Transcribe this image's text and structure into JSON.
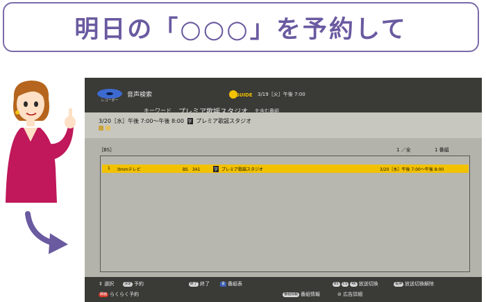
{
  "callout": {
    "text": "明日の「○○○」を予約して"
  },
  "app": {
    "title": "音声検索",
    "logo_text": "レコーダー",
    "guide_logo": "GUIDE",
    "datetime": "3/19［火］午後 7:00"
  },
  "search": {
    "keyword_label": "キーワード",
    "keyword_value": "プレミア歌謡スタジオ",
    "keyword_suffix": "を含む番組"
  },
  "info": {
    "line": "3/20［水］午後 7:00～午後 8:00",
    "title_badge": "字",
    "title": "プレミア歌謡スタジオ"
  },
  "list": {
    "section": "［BS］",
    "page": "1 ／全",
    "count": "1 番組",
    "rows": [
      {
        "num": "1",
        "channel": "itmmテレビ",
        "ch": "BS　341",
        "badge": "字",
        "title": "プレミア歌謡スタジオ",
        "time": "3/20［水］午後 7:00～午後 8:00"
      }
    ]
  },
  "bottombar": {
    "select": "選択",
    "enter_key": "決定",
    "reserve": "予約",
    "end_key": "終了",
    "end": "終了",
    "blue_key": "青",
    "schedule": "番組表",
    "bs_key": "BS",
    "cs_key": "CS",
    "k4_key": "4K",
    "switch_broadcast": "放送切換",
    "cancel_key": "長押",
    "cancel_switch": "放送切換解除",
    "record_key": "録画",
    "easy_reserve": "らくらく予約",
    "info_key": "番組情報",
    "program_info": "番組情報",
    "ad_detail": "広告詳細"
  },
  "colors": {
    "accent": "#6a5aa0",
    "highlight": "#f2c100",
    "bar": "#3a3a36"
  }
}
